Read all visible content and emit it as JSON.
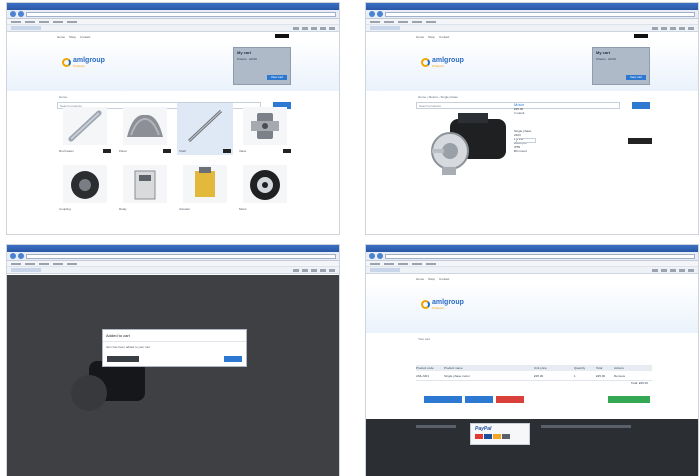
{
  "screens": [
    {
      "id": "category-listing",
      "nav": [
        "Home",
        "Shop",
        "Contact"
      ],
      "brand": {
        "name": "amlgroup",
        "sub": "Products"
      },
      "cart": {
        "title": "My cart",
        "line": "0 items · £0.00",
        "button": "View cart"
      },
      "breadcrumb": "Home",
      "search_placeholder": "Search products",
      "products": [
        {
          "label": "Rod heater"
        },
        {
          "label": "Panel"
        },
        {
          "label": "Shaft"
        },
        {
          "label": "Valve"
        },
        {
          "label": "Coupling"
        },
        {
          "label": "Relay"
        },
        {
          "label": "Actuator"
        },
        {
          "label": "Motor"
        }
      ]
    },
    {
      "id": "product-detail",
      "breadcrumb": "Home › Motors › Single phase",
      "product": {
        "title": "Motor",
        "price": "£95.00",
        "stock": "In stock",
        "buy_label": "Add to cart",
        "specs": [
          "Single phase",
          "240V",
          "1.5 kW",
          "2800 rpm",
          "IP55",
          "B3 mount"
        ]
      }
    },
    {
      "id": "add-to-cart-dialog",
      "dialog": {
        "title": "Added to cart",
        "message": "Item has been added to your cart",
        "continue_label": "Continue shopping",
        "checkout_label": "Checkout"
      }
    },
    {
      "id": "cart-page",
      "page_title": "Your cart",
      "table": {
        "headers": [
          "Product code",
          "Product name",
          "Unit price",
          "Quantity",
          "Total",
          "Actions"
        ],
        "row": [
          "AML-M01",
          "Single phase motor",
          "£95.00",
          "1",
          "£95.00",
          "Remove"
        ],
        "total": "Total: £95.00"
      },
      "buttons": {
        "continue": "Continue shopping",
        "update": "Update cart",
        "clear": "Clear cart",
        "checkout": "Proceed to checkout"
      },
      "payment": {
        "brand": "PayPal"
      }
    }
  ],
  "colors": {
    "accent_blue": "#2d79d1",
    "brand_orange": "#f0a500",
    "footer_dark": "#2b2e33",
    "danger": "#d9403a",
    "success": "#35a853"
  }
}
